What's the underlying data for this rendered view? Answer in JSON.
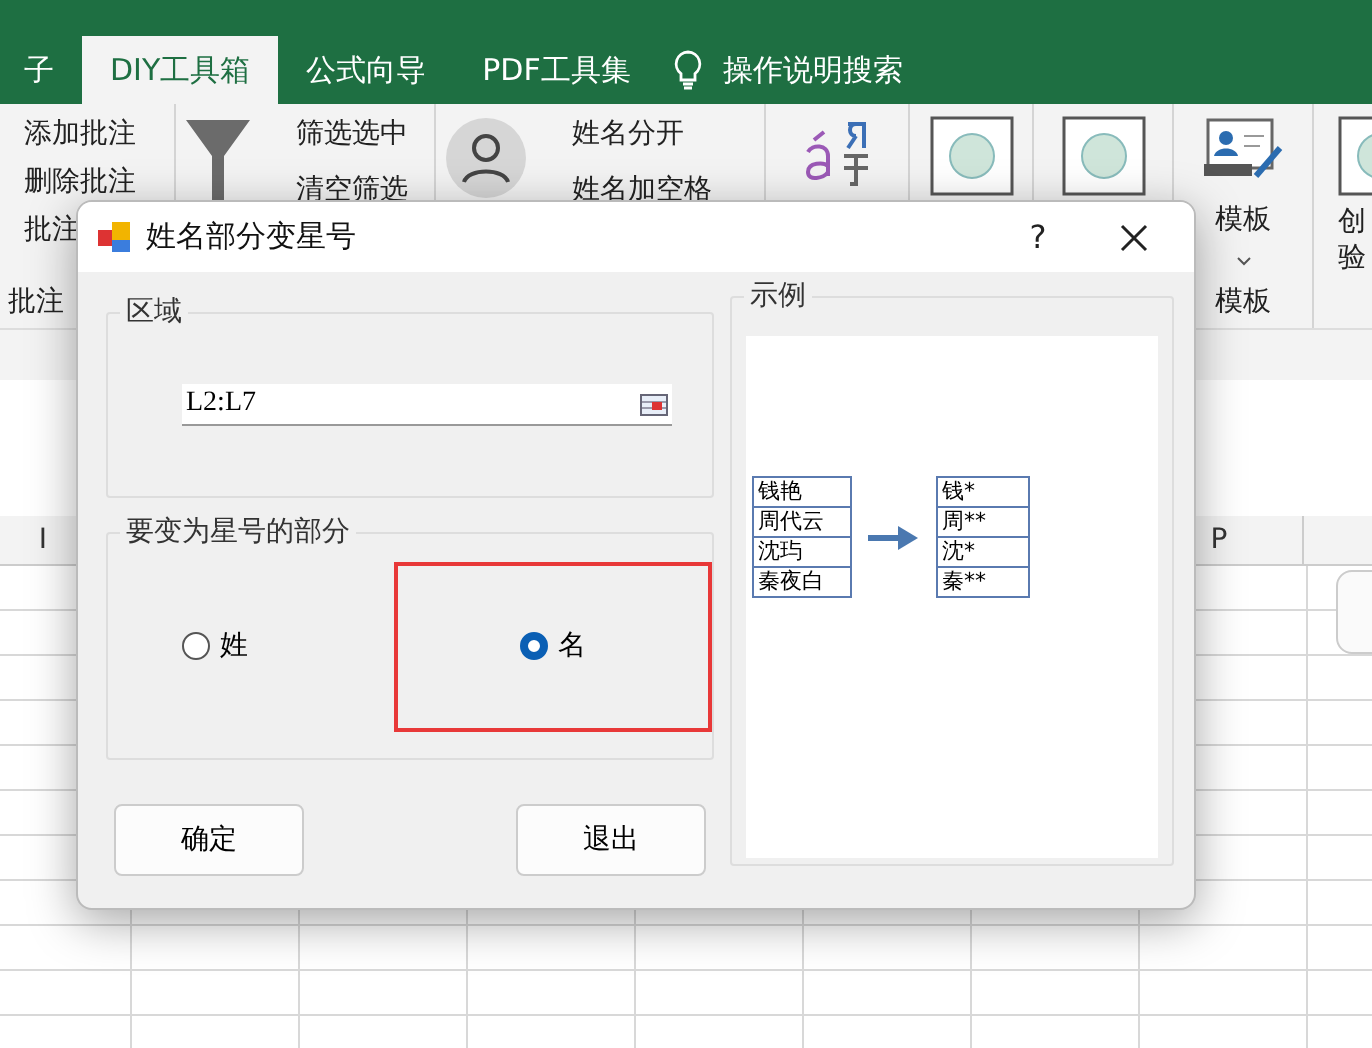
{
  "ribbon_tabs": [
    {
      "label": "子",
      "selected": false
    },
    {
      "label": "DIY工具箱",
      "selected": true
    },
    {
      "label": "公式向导",
      "selected": false
    },
    {
      "label": "PDF工具集",
      "selected": false
    }
  ],
  "tell_me": {
    "label": "操作说明搜索"
  },
  "ribbon": {
    "comment_commands": [
      "添加批注",
      "删除批注",
      "批注"
    ],
    "comment_group": "批注",
    "filter_commands": [
      "筛选选中",
      "清空筛选"
    ],
    "name_commands": [
      "姓名分开",
      "姓名加空格"
    ],
    "template_button": "模板",
    "template_group": "模板",
    "creative_button": [
      "创",
      "验"
    ]
  },
  "column_headers": [
    "I",
    "P"
  ],
  "dialog": {
    "title": "姓名部分变星号",
    "help": "?",
    "region_group": {
      "title": "区域",
      "value": "L2:L7"
    },
    "part_group": {
      "title": "要变为星号的部分",
      "options": [
        {
          "label": "姓",
          "selected": false
        },
        {
          "label": "名",
          "selected": true
        }
      ]
    },
    "buttons": [
      "确定",
      "退出"
    ],
    "example": {
      "title": "示例",
      "before": [
        "钱艳",
        "周代云",
        "沈玙",
        "秦夜白"
      ],
      "after": [
        "钱*",
        "周**",
        "沈*",
        "秦**"
      ]
    }
  }
}
